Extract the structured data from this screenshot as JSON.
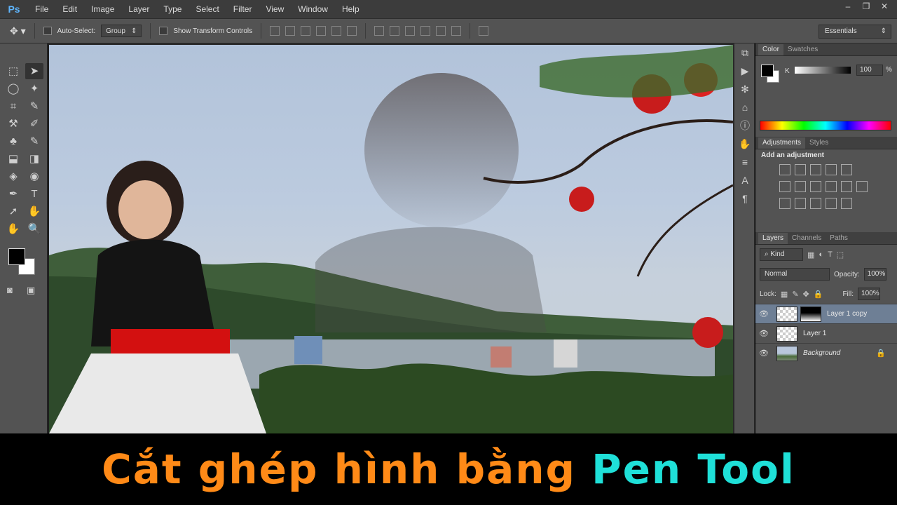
{
  "app": {
    "logo": "Ps"
  },
  "menu": [
    "File",
    "Edit",
    "Image",
    "Layer",
    "Type",
    "Select",
    "Filter",
    "View",
    "Window",
    "Help"
  ],
  "window_controls": [
    "–",
    "❐",
    "✕"
  ],
  "options": {
    "auto_select_label": "Auto-Select:",
    "auto_select_value": "Group",
    "transform_label": "Show Transform Controls",
    "workspace": "Essentials"
  },
  "tools": [
    "⬚",
    "➤",
    "◯",
    "✦",
    "⌗",
    "✎",
    "⚒",
    "✐",
    "♣",
    "✎",
    "⬓",
    "◨",
    "◈",
    "◉",
    "✒",
    "T",
    "➚",
    "✋",
    "✋",
    "🔍"
  ],
  "panels": {
    "color_tabs": [
      "Color",
      "Swatches"
    ],
    "k_label": "K",
    "k_value": "100",
    "k_pct": "%",
    "adjust_tabs": [
      "Adjustments",
      "Styles"
    ],
    "adjust_title": "Add an adjustment",
    "layers_tabs": [
      "Layers",
      "Channels",
      "Paths"
    ],
    "kind": "Kind",
    "blend_mode": "Normal",
    "opacity_label": "Opacity:",
    "opacity_value": "100%",
    "lock_label": "Lock:",
    "fill_label": "Fill:",
    "fill_value": "100%",
    "layers": [
      {
        "name": "Layer 1 copy",
        "selected": true
      },
      {
        "name": "Layer 1",
        "selected": false
      },
      {
        "name": "Background",
        "selected": false
      }
    ]
  },
  "caption": {
    "part1": "Cắt ghép hình bằng",
    "part2": "Pen Tool"
  },
  "colors": {
    "caption_orange": "#ff8a17",
    "caption_cyan": "#1fe0d8",
    "selected_layer": "#6e7f95"
  }
}
